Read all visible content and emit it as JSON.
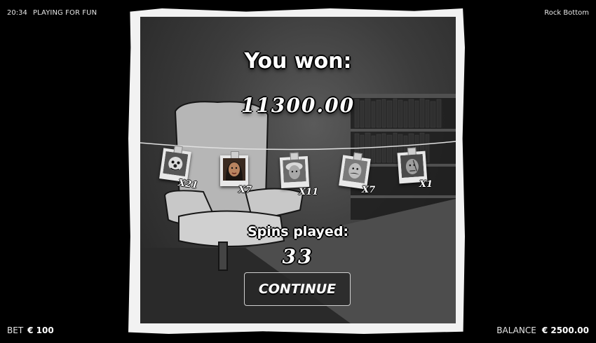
{
  "topbar": {
    "clock": "20:34",
    "mode": "PLAYING FOR FUN",
    "game_title": "Rock Bottom"
  },
  "bottombar": {
    "bet_label": "BET",
    "bet_value": "€ 100",
    "balance_label": "BALANCE",
    "balance_value": "€ 2500.00"
  },
  "popup": {
    "heading": "You won:",
    "amount": "11300.00",
    "spins_label": "Spins played:",
    "spins_value": "33",
    "continue_label": "CONTINUE"
  },
  "photos": [
    {
      "icon": "clown-portrait-icon",
      "multiplier": "X21"
    },
    {
      "icon": "woman-portrait-icon",
      "multiplier": "X7"
    },
    {
      "icon": "old-lady-portrait-icon",
      "multiplier": "X11"
    },
    {
      "icon": "mustache-man-portrait-icon",
      "multiplier": "X7"
    },
    {
      "icon": "scarred-man-portrait-icon",
      "multiplier": "X1"
    }
  ],
  "colors": {
    "background": "#000000",
    "frame": "#f2f2f2",
    "scene": "#3c3c3c",
    "text": "#ffffff"
  }
}
